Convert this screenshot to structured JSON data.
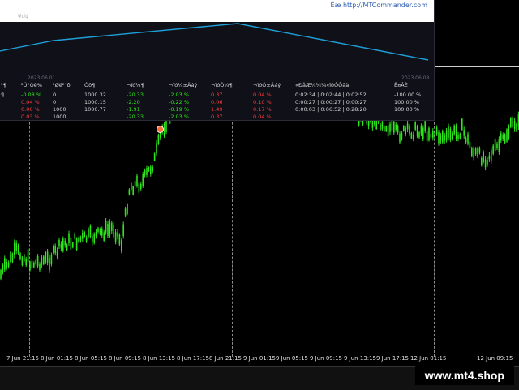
{
  "panel": {
    "brand": "Ëæ http://MTCommander.com",
    "tag": "¥d¢",
    "date_left": "2023.06.01",
    "date_right": "2023.06.08",
    "equity_curve_color": "#1e9fd8",
    "headers": [
      "¹¶",
      "²Ú°Óè%",
      "²Øë²´ð",
      "Óô¶",
      "¬ïó¼¶",
      "¬ïó¼±Äáý",
      "¬ïóÓ¼¶",
      "¬ïóÓ±Äáý",
      "«ÐåÆ¼¼¼«ïóÓÔâà",
      "Ë¤ÂÈ"
    ],
    "rows": [
      {
        "c0": "¶",
        "c1": "-0.08 %",
        "c2": "0",
        "c3": "1000.32",
        "c4": "-20.33",
        "c5": "-2.03 %",
        "c6": "0.37",
        "c7": "0.04 %",
        "c8": "0:02:34 | 0:02:44 | 0:02:52",
        "c9": "-100.00 %",
        "s1": "pos",
        "s4": "pos",
        "s5": "pos",
        "s6": "neg",
        "s7": "neg"
      },
      {
        "c0": "",
        "c1": "0.04 %",
        "c2": "0",
        "c3": "1000.15",
        "c4": "-2.20",
        "c5": "-0.22 %",
        "c6": "0.06",
        "c7": "0.10 %",
        "c8": "0:00:27 | 0:00:27 | 0:00:27",
        "c9": "100.00 %",
        "s1": "neg",
        "s4": "pos",
        "s5": "pos",
        "s6": "neg",
        "s7": "neg"
      },
      {
        "c0": "",
        "c1": "0.06 %",
        "c2": "1000",
        "c3": "1000.77",
        "c4": "-1.91",
        "c5": "-0.19 %",
        "c6": "1.49",
        "c7": "0.17 %",
        "c8": "0:00:03 | 0:06:52 | 0:28:20",
        "c9": "100.00 %",
        "s1": "neg",
        "s4": "pos",
        "s5": "pos",
        "s6": "neg",
        "s7": "neg"
      },
      {
        "c0": "",
        "c1": "0.03 %",
        "c2": "1000",
        "c3": "",
        "c4": "-20.33",
        "c5": "-2.03 %",
        "c6": "0.37",
        "c7": "0.04 %",
        "c8": "",
        "c9": "",
        "s1": "neg",
        "s4": "pos",
        "s5": "pos",
        "s6": "neg",
        "s7": "neg"
      }
    ]
  },
  "time_axis": [
    "7 Jun 21:15",
    "8 Jun 01:15",
    "8 Jun 05:15",
    "8 Jun 09:15",
    "8 Jun 13:15",
    "8 Jun 17:15",
    "8 Jun 21:15",
    "9 Jun 01:15",
    "9 Jun 05:15",
    "9 Jun 09:15",
    "9 Jun 13:15",
    "9 Jun 17:15",
    "12 Jun 01:15",
    "12 Jun 09:15"
  ],
  "watermark": "www.mt4.shop",
  "colors": {
    "candle": "#2ee61b",
    "background": "#000000",
    "grid": "#bbbbbb"
  }
}
